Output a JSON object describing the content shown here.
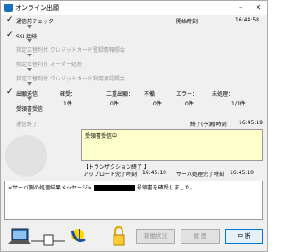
{
  "window": {
    "title": "オンライン出願",
    "minimize": "–",
    "close": "✕"
  },
  "steps": {
    "s1": "通信前チェック",
    "s2": "SSL接続",
    "s3": "指定立替判付 クレジットカード登録情報照会",
    "s4": "指定立替判付 オーダー処理",
    "s5": "指定立替判付 クレジットカード利用承認照会",
    "s6": "出願送信",
    "s7": "受領書受信",
    "s8": "通信終了"
  },
  "start_time": {
    "label": "開始時刻",
    "value": "16:44:58"
  },
  "counts": {
    "normal_label": "確受：",
    "normal_value": "1件",
    "double_label": "二重出願：",
    "double_value": "0件",
    "insufficient_label": "不備：",
    "insufficient_value": "0件",
    "error_label": "エラー：",
    "error_value": "0件",
    "unsent_label": "未処理：",
    "unsent_value": "1/1件"
  },
  "end_time": {
    "label": "終了(予測)時刻",
    "value": "16:45:19"
  },
  "status_text": "受領書受信中",
  "transaction": {
    "header": "【トランザクション終了 】",
    "upload_label": "アップロード完了時刻",
    "upload_value": "16:45:10",
    "server_label": "サーバ処理完了時刻",
    "server_value": "16:45:10"
  },
  "message": {
    "prefix": "<サーバ側の処理結果メッセージ>",
    "suffix": "号領書を確受しました。"
  },
  "buttons": {
    "status": "稼働状況",
    "history": "履 歴",
    "stop": "中 断"
  },
  "colors": {
    "accent": "#0078d7",
    "panel": "#ffffcc"
  }
}
